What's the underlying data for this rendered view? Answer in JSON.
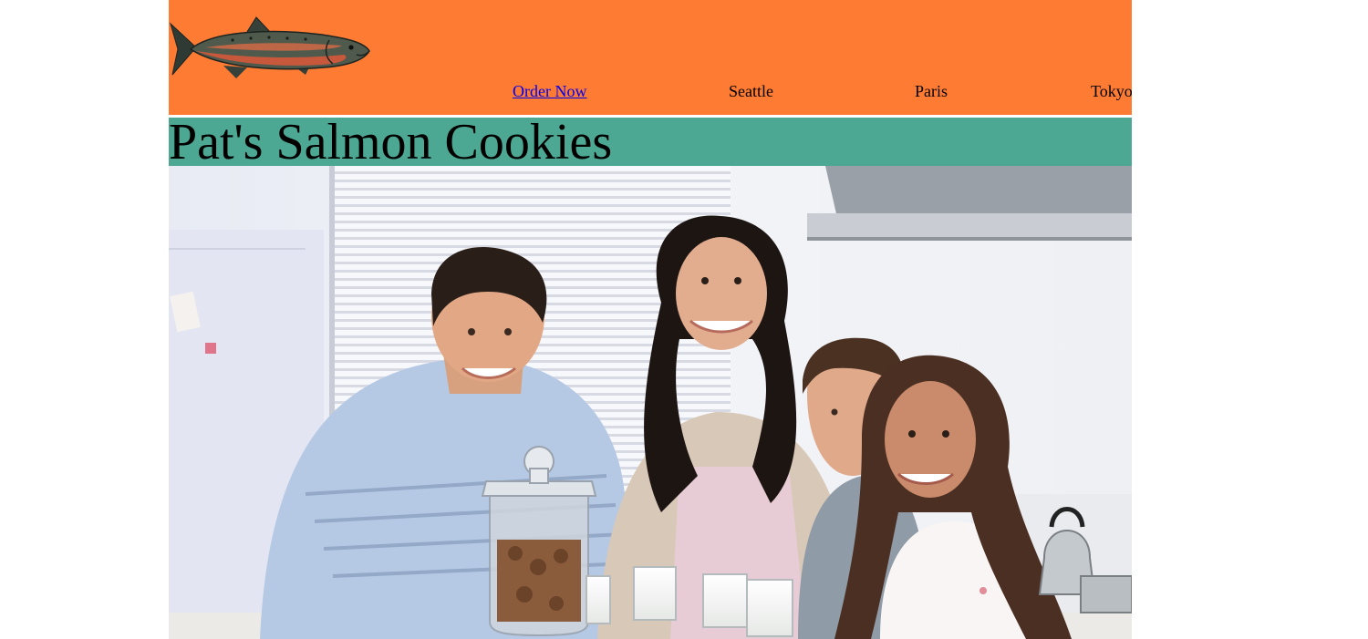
{
  "header": {
    "logo_name": "salmon-logo",
    "background_color": "#fe7b34",
    "nav": {
      "order_label": "Order Now",
      "seattle_label": "Seattle",
      "paris_label": "Paris",
      "tokyo_label": "Tokyo"
    }
  },
  "title_bar": {
    "title": "Pat's Salmon Cookies",
    "background_color": "#4ca893"
  },
  "hero": {
    "image_name": "family-with-cookies-photo"
  }
}
